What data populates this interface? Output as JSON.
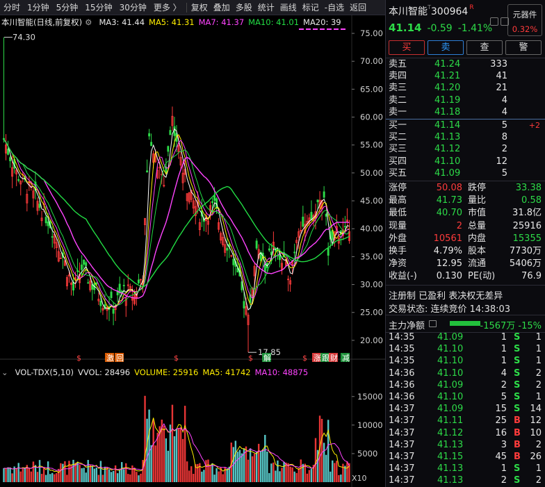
{
  "toolbar": {
    "periods": [
      "分时",
      "1分钟",
      "5分钟",
      "15分钟",
      "30分钟",
      "更多 〉"
    ],
    "tools": [
      "复权",
      "叠加",
      "多股",
      "统计",
      "画线",
      "标记",
      "-自选",
      "返回"
    ]
  },
  "price_legend": {
    "title": "本川智能(日线,前复权)",
    "ma3": "MA3: 41.44",
    "ma5": "MA5: 41.31",
    "ma7": "MA7: 41.37",
    "ma10": "MA10: 41.01",
    "ma20": "MA20: 39"
  },
  "vol_legend": {
    "title": "VOL-TDX(5,10)",
    "vvol": "VVOL: 28496",
    "volume": "VOLUME: 25916",
    "ma5": "MA5: 41742",
    "ma10": "MA10: 48875"
  },
  "colors": {
    "up": "#ff3b3b",
    "down": "#2ddb48",
    "ma3": "#ffffff",
    "ma5": "#ffee00",
    "ma7": "#ff44ff",
    "ma10": "#22dd44",
    "ma20": "#ff44ff",
    "vol_bar": "#5fd9d9"
  },
  "chart_data": {
    "type": "candlestick",
    "price_axis": {
      "min": 17.5,
      "max": 76,
      "ticks": [
        "75.00",
        "70.00",
        "65.00",
        "60.00",
        "55.00",
        "50.00",
        "45.00",
        "40.00",
        "35.00",
        "30.00",
        "25.00",
        "20.00"
      ]
    },
    "high_label": "74.30",
    "low_label": "17.85",
    "volume_axis": {
      "min": 0,
      "max": 18500,
      "ticks": [
        "15000",
        "10000",
        "5000"
      ],
      "unit": "X10"
    },
    "event_markers": [
      "$",
      "激",
      "回",
      "$",
      "$",
      "解",
      "$",
      "涨",
      "跟",
      "财",
      "减"
    ]
  },
  "stock": {
    "name": "本川智能",
    "t_mark": "T",
    "code": "300964",
    "r_mark": "R",
    "price": "41.14",
    "change": "-0.59",
    "pct": "-1.41%",
    "sector_name": "元器件",
    "sector_pct": "0.32%"
  },
  "actions": [
    "买",
    "卖",
    "查",
    "警"
  ],
  "orderbook": {
    "asks": [
      {
        "label": "卖五",
        "price": "41.24",
        "vol": "333"
      },
      {
        "label": "卖四",
        "price": "41.21",
        "vol": "41"
      },
      {
        "label": "卖三",
        "price": "41.20",
        "vol": "21"
      },
      {
        "label": "卖二",
        "price": "41.19",
        "vol": "4"
      },
      {
        "label": "卖一",
        "price": "41.18",
        "vol": "4"
      }
    ],
    "bids": [
      {
        "label": "买一",
        "price": "41.14",
        "vol": "5",
        "chg": "+2"
      },
      {
        "label": "买二",
        "price": "41.13",
        "vol": "8",
        "chg": ""
      },
      {
        "label": "买三",
        "price": "41.12",
        "vol": "2",
        "chg": ""
      },
      {
        "label": "买四",
        "price": "41.10",
        "vol": "12",
        "chg": ""
      },
      {
        "label": "买五",
        "price": "41.09",
        "vol": "5",
        "chg": ""
      }
    ]
  },
  "stats": [
    {
      "k1": "涨停",
      "v1": "50.08",
      "c1": "red",
      "k2": "跌停",
      "v2": "33.38",
      "c2": "green"
    },
    {
      "k1": "最高",
      "v1": "41.73",
      "c1": "green",
      "k2": "量比",
      "v2": "0.58",
      "c2": "green"
    },
    {
      "k1": "最低",
      "v1": "40.70",
      "c1": "green",
      "k2": "市值",
      "v2": "31.8亿",
      "c2": "white"
    },
    {
      "k1": "现量",
      "v1": "2",
      "c1": "red",
      "k2": "总量",
      "v2": "25916",
      "c2": "white"
    },
    {
      "k1": "外盘",
      "v1": "10561",
      "c1": "red",
      "k2": "内盘",
      "v2": "15355",
      "c2": "green"
    },
    {
      "k1": "换手",
      "v1": "4.79%",
      "c1": "white",
      "k2": "股本",
      "v2": "7730万",
      "c2": "white"
    },
    {
      "k1": "净资",
      "v1": "12.95",
      "c1": "white",
      "k2": "流通",
      "v2": "5406万",
      "c2": "white"
    },
    {
      "k1": "收益(-)",
      "v1": "0.130",
      "c1": "white",
      "k2": "PE(动)",
      "v2": "76.9",
      "c2": "white"
    }
  ],
  "registration": "注册制 已盈利 表决权无差异",
  "trade_status": "交易状态: 连续竞价 14:38:03",
  "main_flow": {
    "label": "主力净额",
    "value": "-1567万 -15%"
  },
  "ticks": [
    {
      "t": "14:35",
      "p": "41.09",
      "v": "1",
      "d": "S",
      "n": "1"
    },
    {
      "t": "14:35",
      "p": "41.10",
      "v": "1",
      "d": "S",
      "n": "1"
    },
    {
      "t": "14:35",
      "p": "41.10",
      "v": "1",
      "d": "S",
      "n": "1"
    },
    {
      "t": "14:36",
      "p": "41.10",
      "v": "4",
      "d": "S",
      "n": "2"
    },
    {
      "t": "14:36",
      "p": "41.09",
      "v": "2",
      "d": "S",
      "n": "2"
    },
    {
      "t": "14:36",
      "p": "41.10",
      "v": "5",
      "d": "S",
      "n": "1"
    },
    {
      "t": "14:37",
      "p": "41.09",
      "v": "15",
      "d": "S",
      "n": "14"
    },
    {
      "t": "14:37",
      "p": "41.11",
      "v": "25",
      "d": "B",
      "n": "12"
    },
    {
      "t": "14:37",
      "p": "41.12",
      "v": "16",
      "d": "B",
      "n": "10"
    },
    {
      "t": "14:37",
      "p": "41.13",
      "v": "3",
      "d": "B",
      "n": "2"
    },
    {
      "t": "14:37",
      "p": "41.15",
      "v": "45",
      "d": "B",
      "n": "26"
    },
    {
      "t": "14:37",
      "p": "41.13",
      "v": "1",
      "d": "S",
      "n": "1"
    },
    {
      "t": "14:37",
      "p": "41.13",
      "v": "2",
      "d": "S",
      "n": "2"
    }
  ]
}
